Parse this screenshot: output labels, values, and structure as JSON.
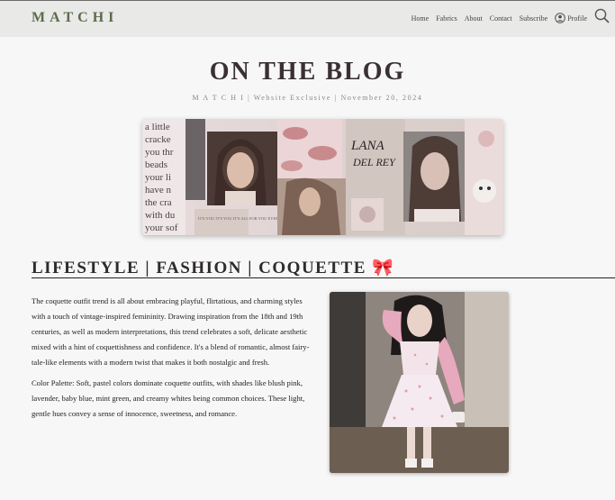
{
  "header": {
    "brand": "MATCHI",
    "nav": [
      "Home",
      "Fabrics",
      "About",
      "Contact",
      "Subscribe"
    ],
    "profile_label": "Profile",
    "icons": {
      "profile": "user-circle-icon",
      "search": "search-icon"
    }
  },
  "blog": {
    "title": "ON THE BLOG",
    "meta": "M A T C H I | Website Exclusive | November 20, 2024"
  },
  "banner": {
    "poem_lines": [
      "a little",
      "cracke",
      "you thr",
      "beads",
      "your li",
      "have n",
      "the cra",
      "with du",
      "your sof"
    ],
    "logo_line1": "LANA",
    "logo_line2": "DEL REY",
    "caption": "IT'S YOU IT'S YOU IT'S ALL FOR YOU EVERYTHING I DO"
  },
  "section": {
    "title": "LIFESTYLE | FASHION | COQUETTE",
    "emoji": "🎀",
    "paragraphs": [
      "The coquette outfit trend is all about embracing playful, flirtatious, and charming styles with a touch of vintage-inspired femininity. Drawing inspiration from the 18th and 19th centuries, as well as modern interpretations, this trend celebrates a soft, delicate aesthetic mixed with a hint of coquettishness and confidence. It's a blend of romantic, almost fairy-tale-like elements with a modern twist that makes it both nostalgic and fresh.",
      "Color Palette: Soft, pastel colors dominate coquette outfits, with shades like blush pink, lavender, baby blue, mint green, and creamy whites being common choices. These light, gentle hues convey a sense of innocence, sweetness, and romance."
    ]
  },
  "colors": {
    "brand": "#5b6b4a",
    "header_bg": "#e9e9e7",
    "page_bg": "#f7f7f7"
  }
}
